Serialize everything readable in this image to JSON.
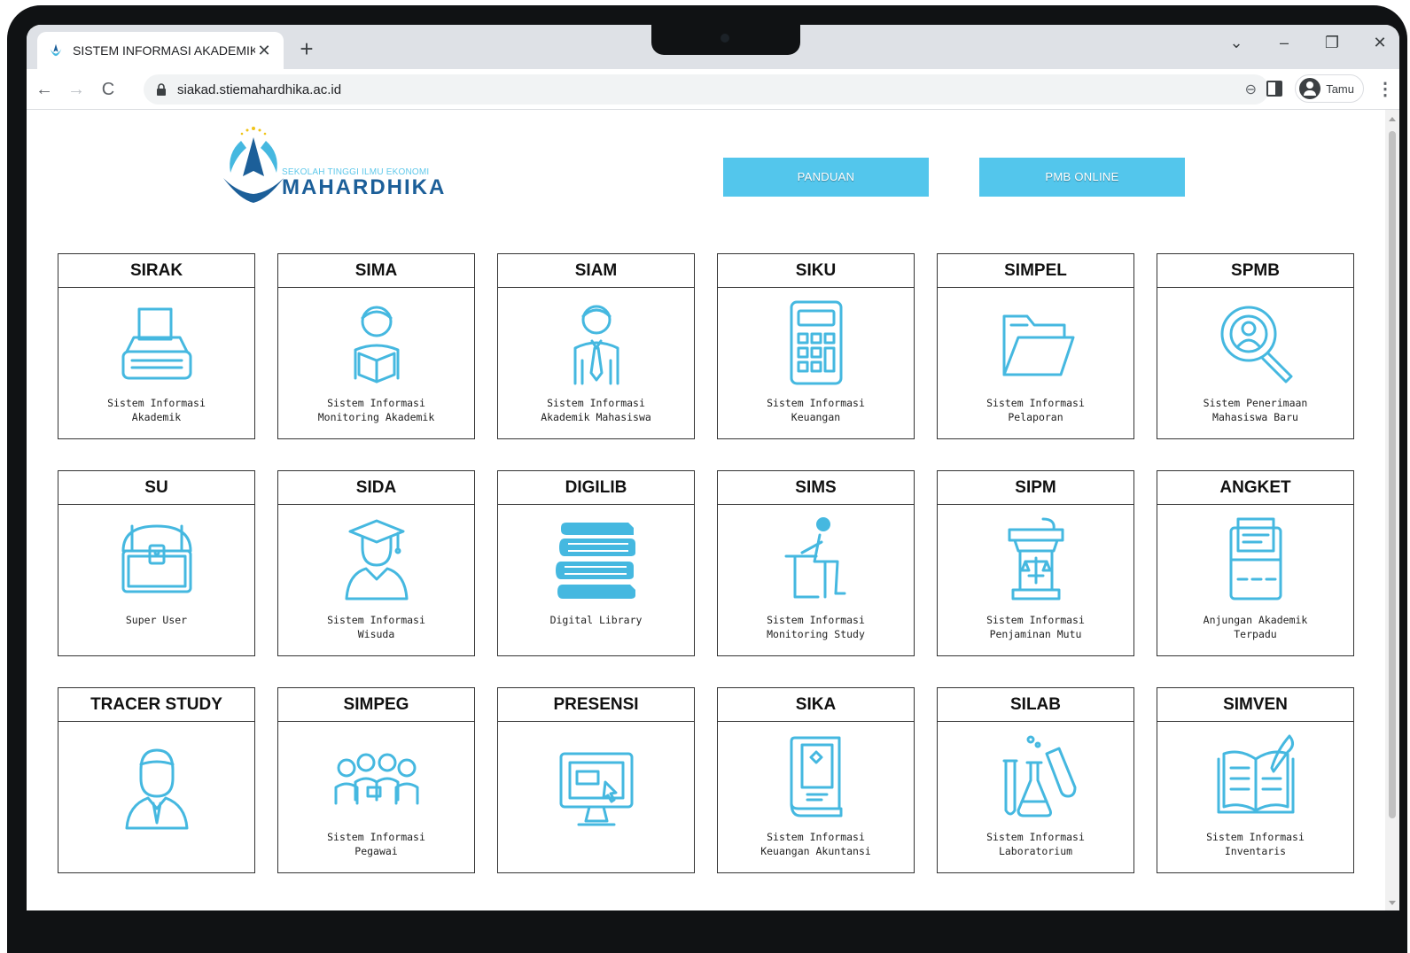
{
  "browser": {
    "tab_title": "SISTEM INFORMASI AKADEMIK",
    "tab_close": "✕",
    "new_tab": "+",
    "url": "siakad.stiemahardhika.ac.id",
    "profile_name": "Tamu",
    "window_controls": {
      "dropdown": "⌄",
      "minimize": "–",
      "restore": "❐",
      "close": "✕"
    },
    "nav": {
      "back": "←",
      "forward": "→",
      "reload": "C"
    },
    "menu": "⋮",
    "zoom": "⊖"
  },
  "header": {
    "logo_sub": "SEKOLAH TINGGI ILMU EKONOMI",
    "logo_main": "MAHARDHIKA",
    "buttons": {
      "panduan": "PANDUAN",
      "pmb": "PMB ONLINE"
    }
  },
  "colors": {
    "accent": "#53c6ec",
    "icon": "#45b8e0",
    "logo_blue": "#1c5f99"
  },
  "modules": [
    {
      "title": "SIRAK",
      "desc": "Sistem Informasi\nAkademik",
      "icon": "typewriter-icon"
    },
    {
      "title": "SIMA",
      "desc": "Sistem Informasi\nMonitoring Akademik",
      "icon": "reading-person-icon"
    },
    {
      "title": "SIAM",
      "desc": "Sistem Informasi\nAkademik Mahasiswa",
      "icon": "student-icon"
    },
    {
      "title": "SIKU",
      "desc": "Sistem Informasi\nKeuangan",
      "icon": "calculator-icon"
    },
    {
      "title": "SIMPEL",
      "desc": "Sistem Informasi\nPelaporan",
      "icon": "folder-icon"
    },
    {
      "title": "SPMB",
      "desc": "Sistem Penerimaan\nMahasiswa Baru",
      "icon": "search-user-icon"
    },
    {
      "title": "SU",
      "desc": "Super User",
      "icon": "treasure-chest-icon"
    },
    {
      "title": "SIDA",
      "desc": "Sistem Informasi\nWisuda",
      "icon": "graduate-icon"
    },
    {
      "title": "DIGILIB",
      "desc": "Digital Library",
      "icon": "books-icon"
    },
    {
      "title": "SIMS",
      "desc": "Sistem Informasi\nMonitoring Study",
      "icon": "student-desk-icon"
    },
    {
      "title": "SIPM",
      "desc": "Sistem Informasi\nPenjaminan Mutu",
      "icon": "podium-scale-icon"
    },
    {
      "title": "ANGKET",
      "desc": "Anjungan Akademik\nTerpadu",
      "icon": "kiosk-icon"
    },
    {
      "title": "TRACER STUDY",
      "desc": "",
      "icon": "person-icon"
    },
    {
      "title": "SIMPEG",
      "desc": "Sistem Informasi\nPegawai",
      "icon": "team-icon"
    },
    {
      "title": "PRESENSI",
      "desc": "",
      "icon": "monitor-click-icon"
    },
    {
      "title": "SIKA",
      "desc": "Sistem Informasi\nKeuangan Akuntansi",
      "icon": "book-icon"
    },
    {
      "title": "SILAB",
      "desc": "Sistem Informasi\nLaboratorium",
      "icon": "lab-icon"
    },
    {
      "title": "SIMVEN",
      "desc": "Sistem Informasi\nInventaris",
      "icon": "open-book-icon"
    }
  ]
}
